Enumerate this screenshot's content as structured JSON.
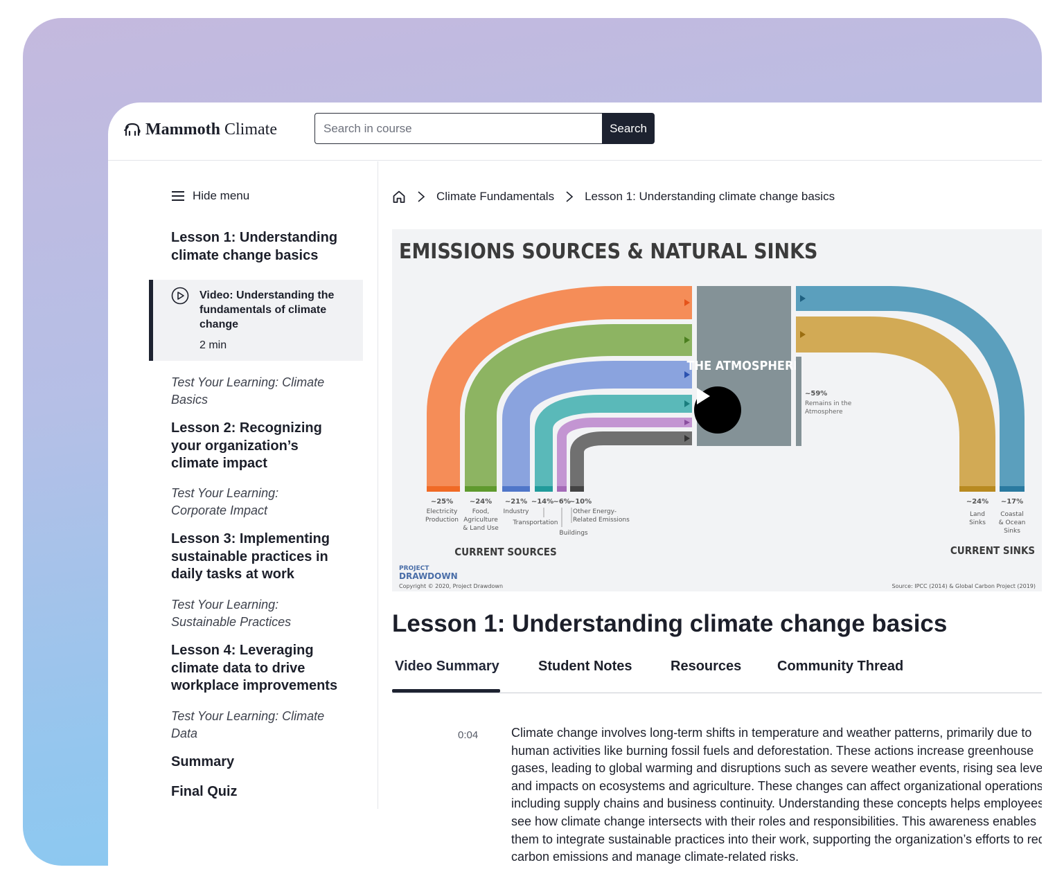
{
  "app": {
    "brand_bold": "Mammoth",
    "brand_light": "Climate"
  },
  "search": {
    "placeholder": "Search in course",
    "button_label": "Search"
  },
  "sidebar": {
    "hide_menu_label": "Hide menu",
    "lesson1": "Lesson 1: Understanding climate change basics",
    "active_item": {
      "title": "Video: Understanding the fundamentals of climate change",
      "duration": "2 min"
    },
    "test1": "Test Your Learning: Climate Basics",
    "lesson2": "Lesson 2: Recognizing your organization’s climate impact",
    "test2": "Test Your Learning: Corporate Impact",
    "lesson3": "Lesson 3: Implementing sustainable practices in daily tasks at work",
    "test3": "Test Your Learning: Sustainable Practices",
    "lesson4": "Lesson 4: Leveraging climate data to drive workplace improvements",
    "test4": "Test Your Learning: Climate Data",
    "summary": "Summary",
    "final_quiz": "Final Quiz"
  },
  "breadcrumb": {
    "course": "Climate Fundamentals",
    "lesson": "Lesson 1:  Understanding climate change basics"
  },
  "infographic": {
    "title": "EMISSIONS SOURCES & NATURAL SINKS",
    "atmosphere_label": "THE ATMOSPHERE",
    "remains_pct": "~59%",
    "remains_line1": "Remains in the",
    "remains_line2": "Atmosphere",
    "current_sources": "CURRENT SOURCES",
    "current_sinks": "CURRENT SINKS",
    "sources": [
      {
        "pct": "~25%",
        "label1": "Electricity",
        "label2": "Production",
        "color": "#f58d58"
      },
      {
        "pct": "~24%",
        "label1": "Food,",
        "label2": "Agriculture",
        "label3": "& Land Use",
        "color": "#8db462"
      },
      {
        "pct": "~21%",
        "label1": "Industry",
        "color": "#8aa3de"
      },
      {
        "pct": "~14%",
        "label1": "Transportation",
        "color": "#5ab9b9"
      },
      {
        "pct": "~6%",
        "label1": "Buildings",
        "color": "#c395d2"
      },
      {
        "pct": "~10%",
        "label1": "Other Energy-",
        "label2": "Related Emissions",
        "color": "#707070"
      }
    ],
    "sinks": [
      {
        "pct": "~24%",
        "label1": "Land",
        "label2": "Sinks",
        "color": "#d2aa55"
      },
      {
        "pct": "~17%",
        "label1": "Coastal",
        "label2": "& Ocean",
        "label3": "Sinks",
        "color": "#5b9fbd"
      }
    ],
    "logo_line1": "PROJECT",
    "logo_line2": "DRAWDOWN",
    "copyright": "Copyright © 2020, Project Drawdown",
    "source": "Source: IPCC (2014) & Global Carbon Project (2019)"
  },
  "lesson": {
    "title": "Lesson 1: Understanding climate change basics",
    "tabs": [
      "Video Summary",
      "Student Notes",
      "Resources",
      "Community Thread"
    ],
    "transcript": {
      "timestamp": "0:04",
      "text": "Climate change involves long-term shifts in temperature and weather patterns, primarily due to human activities like burning fossil fuels and deforestation. These actions increase greenhouse gases, leading to global warming and disruptions such as severe weather events, rising sea levels, and impacts on ecosystems and agriculture. These changes can affect organizational operations, including supply chains and business continuity. Understanding these concepts helps employees see how climate change intersects with their roles and responsibilities. This awareness enables them to integrate sustainable practices into their work, supporting the organization’s efforts to reduce carbon emissions and manage climate-related risks."
    }
  },
  "colors": {
    "accent_dark": "#1d2230",
    "atmosphere": "#849297"
  }
}
